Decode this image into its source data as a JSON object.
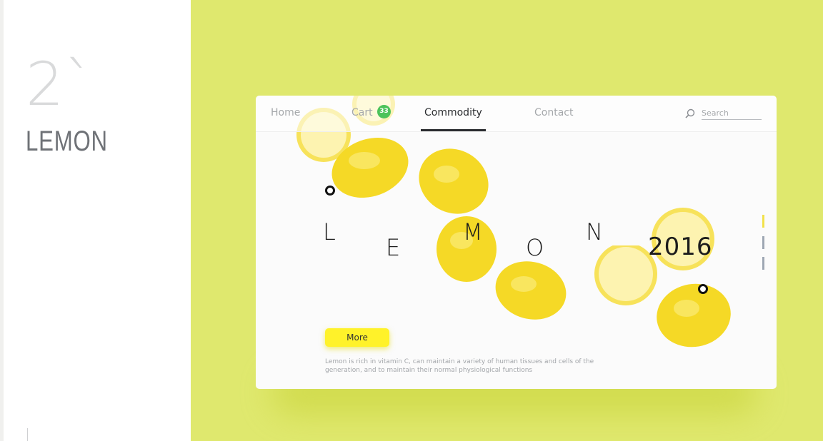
{
  "sidebar": {
    "number": "2`",
    "brand": "LEMON"
  },
  "nav": {
    "items": [
      {
        "label": "Home"
      },
      {
        "label": "Cart",
        "badge": "33"
      },
      {
        "label": "Commodity",
        "active": true
      },
      {
        "label": "Contact"
      }
    ],
    "search_placeholder": "Search"
  },
  "hero": {
    "letters": [
      "L",
      "E",
      "M",
      "O",
      "N"
    ],
    "year": "2016",
    "button_label": "More",
    "description": "Lemon is rich in vitamin C, can maintain a variety of human tissues and cells of the generation, and to maintain their normal physiological functions"
  },
  "colors": {
    "background": "#dfe86e",
    "accent_yellow": "#fff22a",
    "badge_green": "#4cc35b",
    "pager_active": "#f2e14a",
    "pager_inactive": "#9ea7b3"
  },
  "pager": {
    "count": 3,
    "active_index": 0
  }
}
